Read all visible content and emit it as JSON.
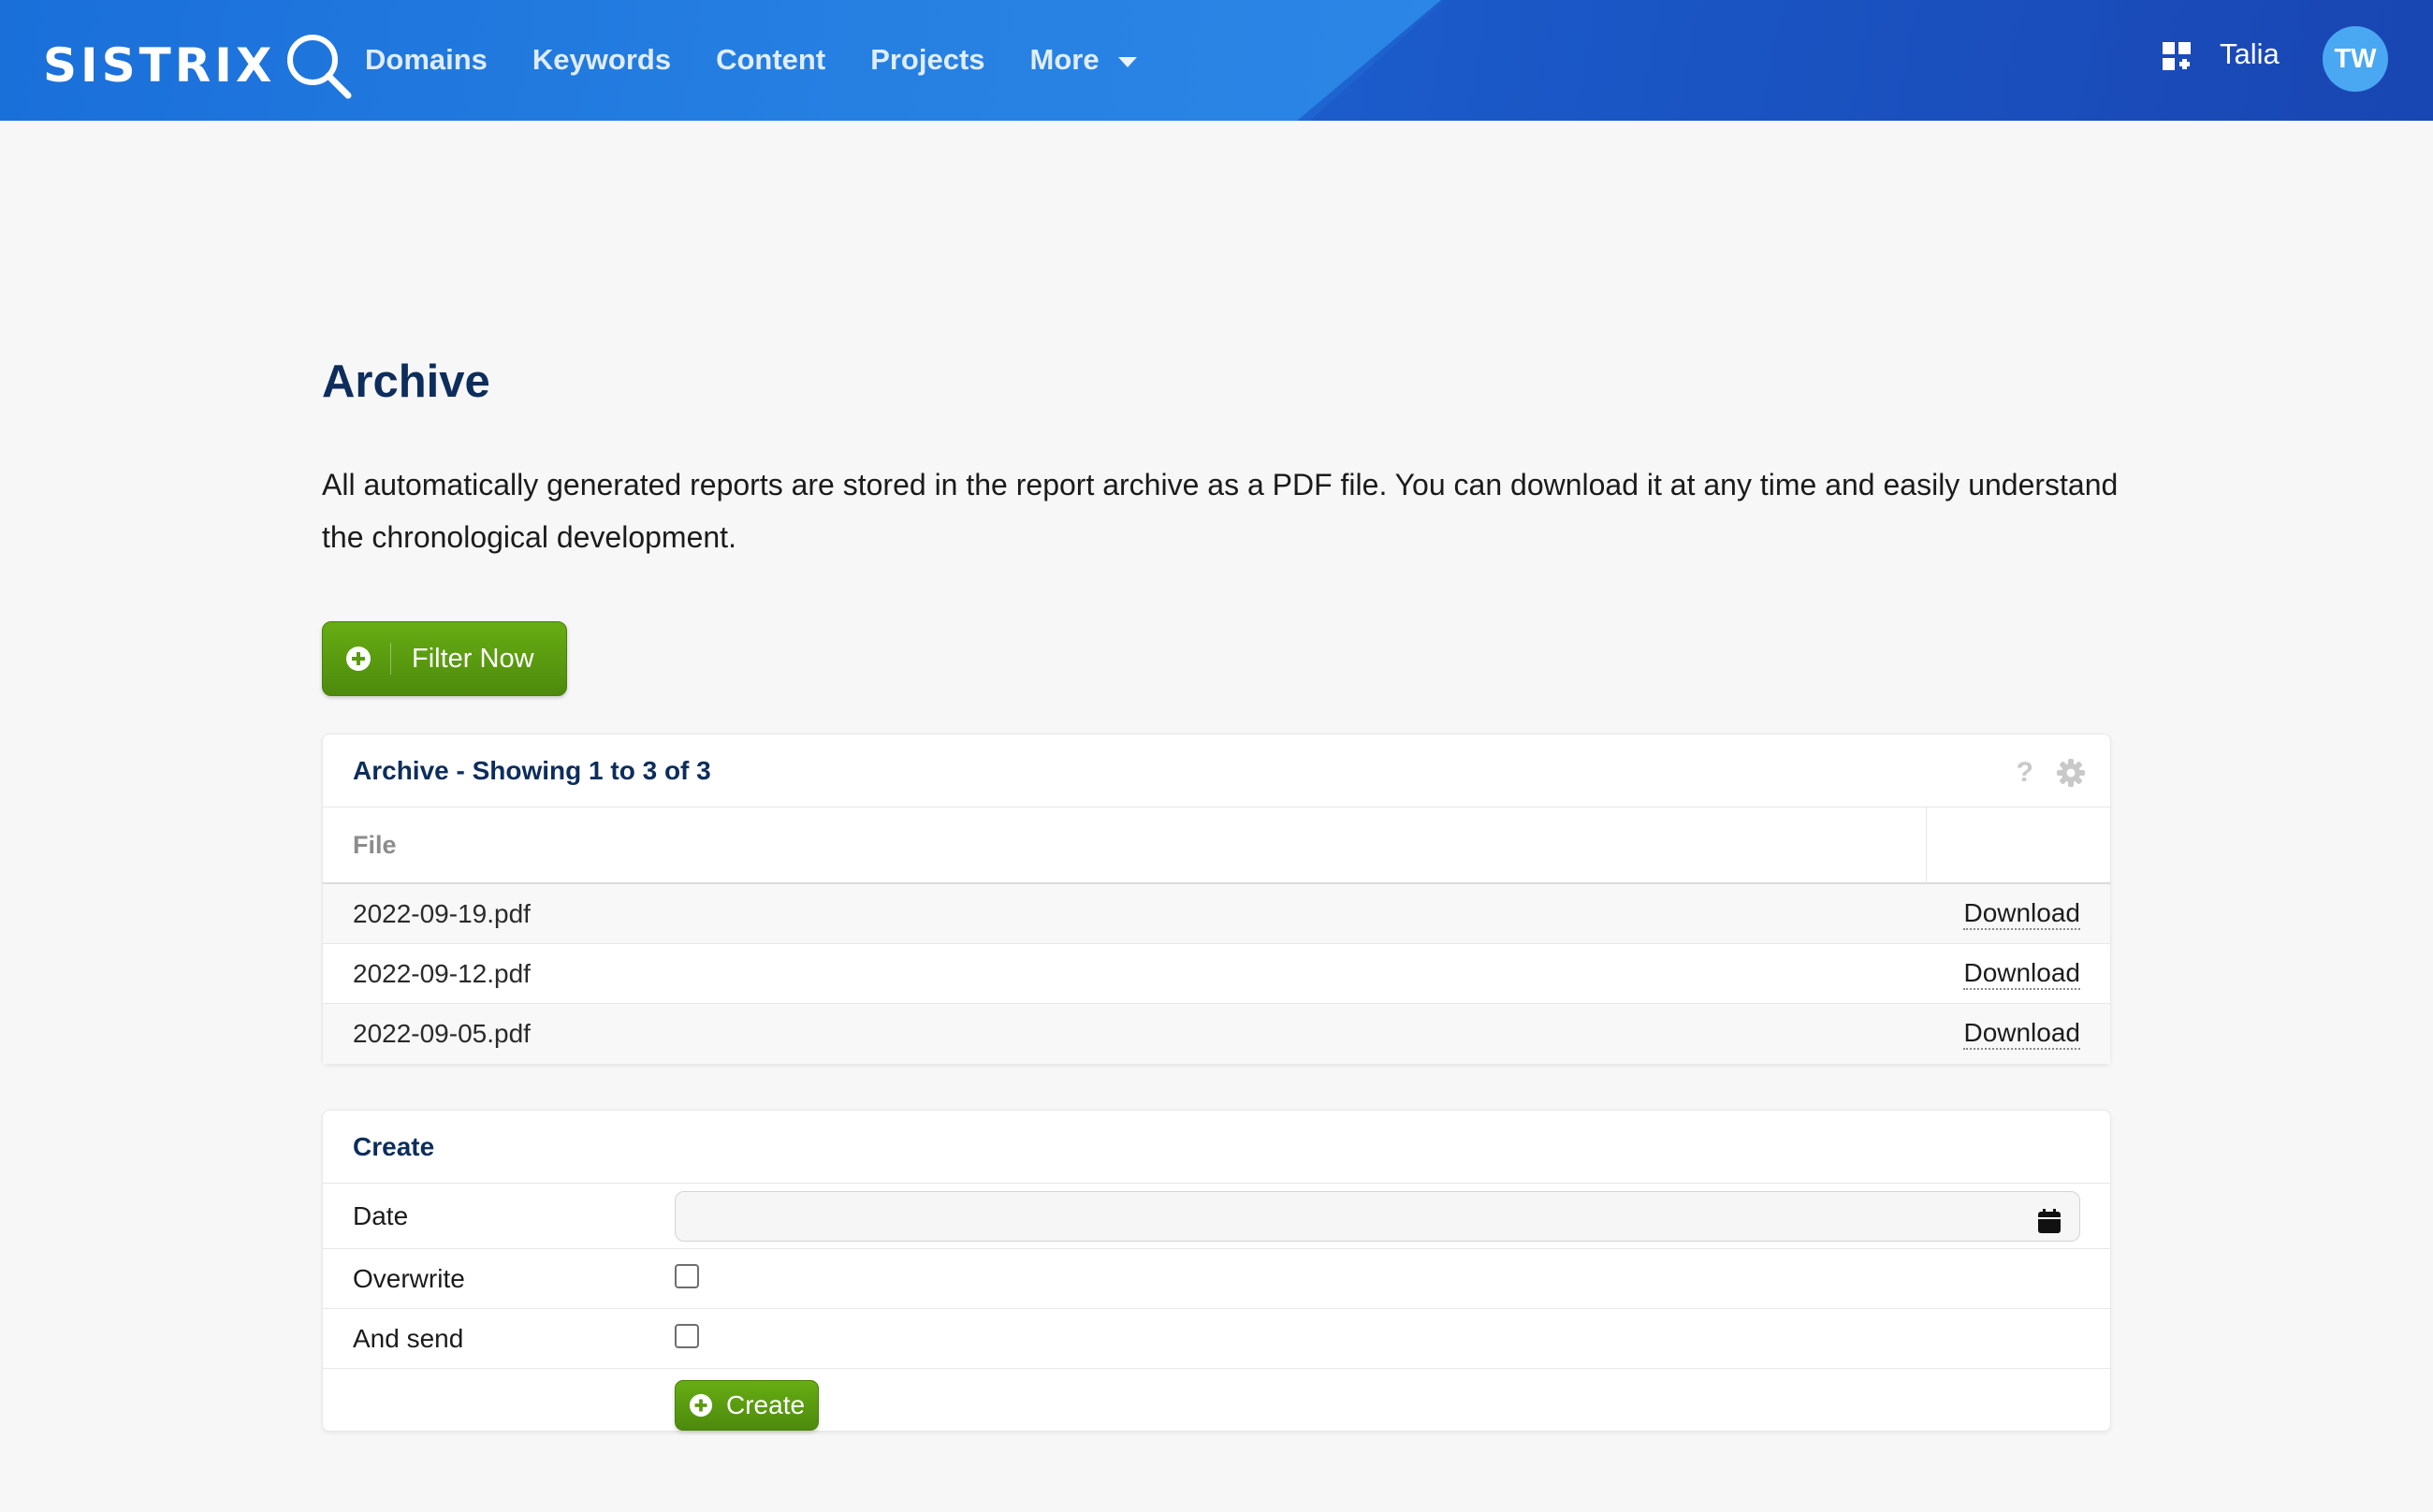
{
  "brand": {
    "logo_text": "SISTRIX"
  },
  "nav": {
    "items": [
      "Domains",
      "Keywords",
      "Content",
      "Projects",
      "More"
    ]
  },
  "user": {
    "name": "Talia",
    "initials": "TW"
  },
  "page": {
    "title": "Archive",
    "intro": "All automatically generated reports are stored in the report archive as a PDF file. You can download it at any time and easily understand the chronological development."
  },
  "filter_button": {
    "label": "Filter Now"
  },
  "archive": {
    "heading": "Archive - Showing 1 to 3 of 3",
    "help_icon": "?",
    "column_file": "File",
    "rows": [
      {
        "file": "2022-09-19.pdf",
        "action": "Download"
      },
      {
        "file": "2022-09-12.pdf",
        "action": "Download"
      },
      {
        "file": "2022-09-05.pdf",
        "action": "Download"
      }
    ]
  },
  "create": {
    "heading": "Create",
    "date_label": "Date",
    "date_value": "",
    "overwrite_label": "Overwrite",
    "overwrite_checked": false,
    "send_label": "And send",
    "send_checked": false,
    "submit_label": "Create"
  },
  "colors": {
    "nav_blue": "#1f6fd9",
    "title_navy": "#0d2d5c",
    "button_green": "#5a9b10",
    "avatar_blue": "#4aa8f2"
  },
  "icons": [
    "magnifier-icon",
    "caret-down-icon",
    "apps-grid-icon",
    "plus-circle-icon",
    "help-icon",
    "gear-icon",
    "calendar-icon"
  ]
}
